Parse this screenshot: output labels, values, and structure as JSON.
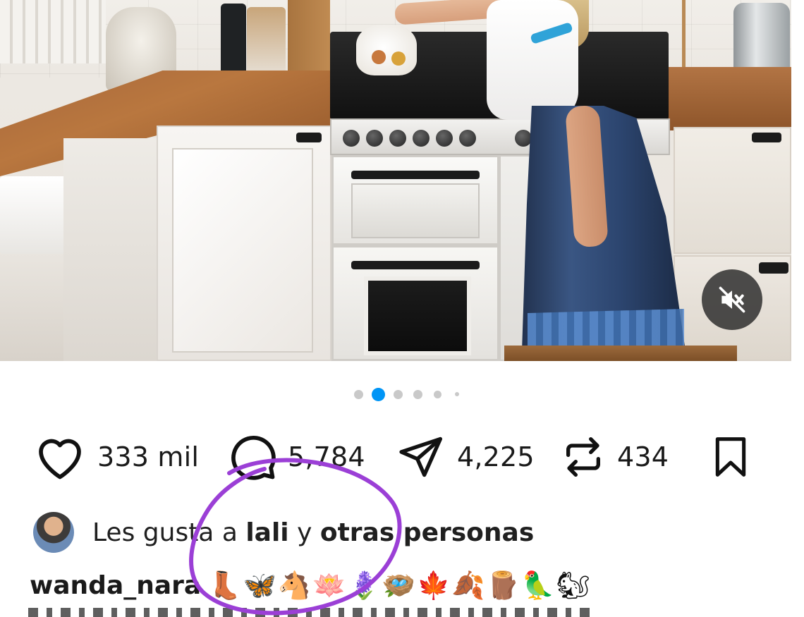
{
  "post": {
    "media": {
      "description_icon": "kitchen-photo",
      "mute_icon": "speaker-muted-icon",
      "carousel": {
        "total_slides": 6,
        "active_index": 1,
        "active_color": "#0095f6",
        "inactive_color": "#c9c9c9"
      }
    },
    "actions": {
      "like": {
        "icon": "heart-icon",
        "count": "333 mil"
      },
      "comment": {
        "icon": "comment-bubble-icon",
        "count": "5,784"
      },
      "share": {
        "icon": "paper-plane-icon",
        "count": "4,225"
      },
      "repost": {
        "icon": "repost-arrows-icon",
        "count": "434"
      },
      "save": {
        "icon": "bookmark-icon"
      }
    },
    "liked_by": {
      "prefix": "Les gusta a ",
      "user": "lali",
      "middle": " y ",
      "others": "otras personas"
    },
    "caption": {
      "username": "wanda_nara",
      "emojis": "👢🦋🐴🪷🪻🪺🍁🍂🪵🦜🐿"
    },
    "annotation": {
      "color": "#9b3fd6"
    }
  }
}
